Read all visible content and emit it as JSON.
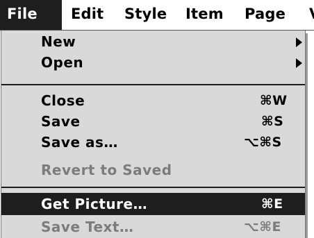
{
  "menubar": {
    "items": [
      {
        "label": "File"
      },
      {
        "label": "Edit"
      },
      {
        "label": "Style"
      },
      {
        "label": "Item"
      },
      {
        "label": "Page"
      },
      {
        "label": "V"
      }
    ]
  },
  "file_menu": {
    "new": {
      "label": "New"
    },
    "open": {
      "label": "Open"
    },
    "close": {
      "label": "Close",
      "shortcut": "⌘W"
    },
    "save": {
      "label": "Save",
      "shortcut": "⌘S"
    },
    "save_as": {
      "label": "Save as…",
      "shortcut": "⌥⌘S"
    },
    "revert": {
      "label": "Revert to Saved"
    },
    "get_picture": {
      "label": "Get Picture…",
      "shortcut": "⌘E"
    },
    "save_text": {
      "label": "Save Text…",
      "shortcut": "⌥⌘E"
    }
  },
  "colors": {
    "highlight": "#1e1e1e",
    "menu_background": "#d9d9d9",
    "disabled_text": "#7c7c7c"
  }
}
